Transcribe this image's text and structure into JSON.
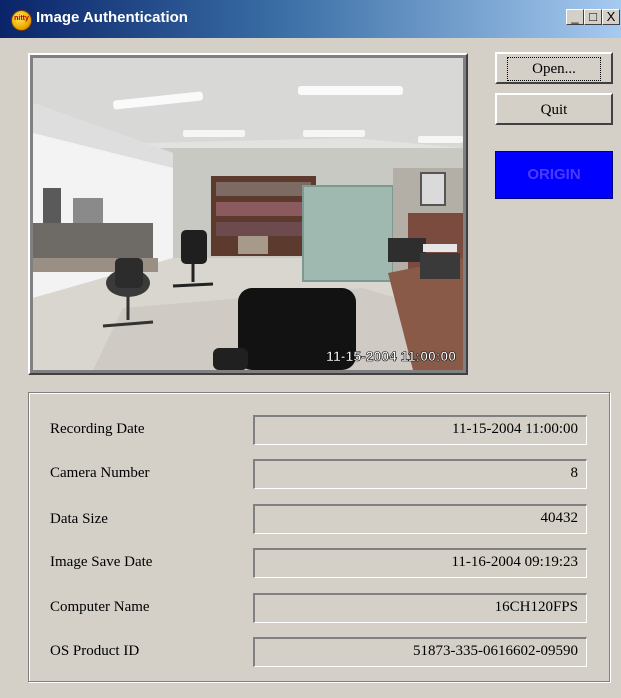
{
  "window": {
    "title": "Image Authentication",
    "app_icon_text": "nitty",
    "controls": {
      "minimize": "_",
      "maximize": "□",
      "close": "X"
    }
  },
  "preview": {
    "overlay_timestamp": "11-15-2004 11:00:00"
  },
  "buttons": {
    "open_label": "Open...",
    "quit_label": "Quit"
  },
  "status": {
    "origin_label": "ORIGIN",
    "origin_bg": "#0000ff"
  },
  "info": {
    "rows": [
      {
        "label": "Recording Date",
        "value": "11-15-2004 11:00:00"
      },
      {
        "label": "Camera Number",
        "value": "8"
      },
      {
        "label": "Data Size",
        "value": "40432"
      },
      {
        "label": "Image Save Date",
        "value": "11-16-2004 09:19:23"
      },
      {
        "label": "Computer Name",
        "value": "16CH120FPS"
      },
      {
        "label": "OS Product ID",
        "value": "51873-335-0616602-09590"
      }
    ]
  }
}
